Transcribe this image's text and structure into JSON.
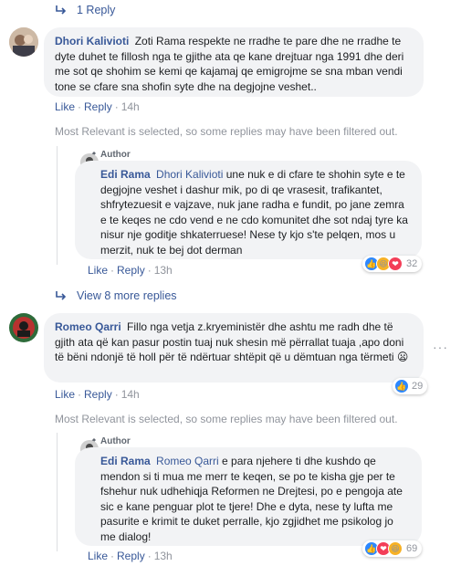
{
  "top_reply": {
    "label": "1 Reply"
  },
  "comment1": {
    "author": "Dhori Kalivioti",
    "text": "Zoti Rama respekte ne rradhe te pare dhe ne rradhe te dyte duhet te fillosh nga te gjithe ata qe kane drejtuar nga 1991 dhe deri me sot qe shohim se kemi qe kajamaj qe emigrojme se sna mban vendi tone se cfare sna shofin syte dhe na degjojne veshet..",
    "like": "Like",
    "reply": "Reply",
    "time": "14h"
  },
  "filter_note_1": "Most Relevant is selected, so some replies may have been filtered out.",
  "reply1": {
    "badge": "Author",
    "author": "Edi Rama",
    "mention": "Dhori Kalivioti",
    "text": " une nuk e di cfare te shohin syte e te degjojne veshet i dashur mik, po di qe vrasesit, trafikantet, shfrytezuesit e vajzave, nuk jane radha e fundit, po jane zemra e te keqes ne cdo vend e ne cdo komunitet dhe sot ndaj tyre ka nisur nje goditje shkaterruese! Nese ty kjo s'te pelqen, mos u merzit, nuk te bej dot derman",
    "like": "Like",
    "reply": "Reply",
    "time": "13h",
    "reaction_count": "32"
  },
  "view_more": {
    "label": "View 8 more replies"
  },
  "comment2": {
    "author": "Romeo Qarri",
    "text": "Fillo nga vetja z.kryeministër dhe ashtu me radh dhe të gjith ata që kan pasur postin tuaj nuk shesin më përrallat tuaja ,apo doni të bëni ndonjë të holl për të ndërtuar shtëpit që u dëmtuan nga tërmeti",
    "emoji": "😦",
    "like": "Like",
    "reply": "Reply",
    "time": "14h",
    "reaction_count": "29",
    "more": "···"
  },
  "filter_note_2": "Most Relevant is selected, so some replies may have been filtered out.",
  "reply2": {
    "badge": "Author",
    "author": "Edi Rama",
    "mention": "Romeo Qarri",
    "text": " e para njehere ti dhe kushdo qe mendon si ti mua me merr te keqen, se po te kisha gje per te fshehur nuk udhehiqja Reformen ne Drejtesi, po e pengoja ate sic e kane penguar plot te tjere! Dhe e dyta, nese ty lufta me pasurite e krimit te duket perralle, kjo zgjidhet me psikolog jo me dialog!",
    "like": "Like",
    "reply": "Reply",
    "time": "13h",
    "reaction_count": "69"
  },
  "colors": {
    "link": "#385898",
    "bubble": "#f2f3f5",
    "meta": "#90949c",
    "like_blue": "#2d88ff",
    "haha_yellow": "#f7b125",
    "love_red": "#f33e58"
  }
}
